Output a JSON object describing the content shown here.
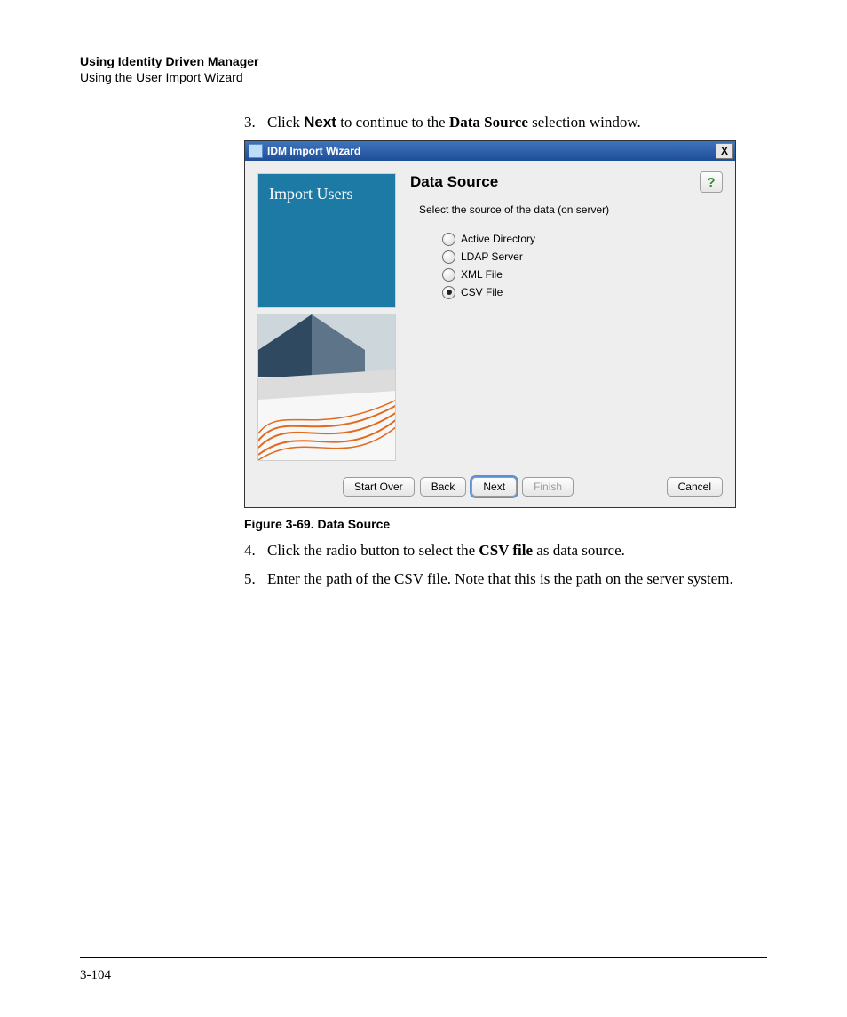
{
  "header": {
    "line1": "Using Identity Driven Manager",
    "line2": "Using the User Import Wizard"
  },
  "steps": {
    "s3": {
      "num": "3.",
      "pre": "Click ",
      "b1": "Next",
      "mid": " to continue to the ",
      "b2": "Data Source",
      "post": " selection window."
    },
    "s4": {
      "num": "4.",
      "pre": "Click the radio button to select the ",
      "b1": "CSV file",
      "post": " as data source."
    },
    "s5": {
      "num": "5.",
      "text": "Enter the path of the CSV file. Note that this is the path on the server system."
    }
  },
  "figure_caption": "Figure 3-69. Data Source",
  "dialog": {
    "title": "IDM Import Wizard",
    "side_title": "Import Users",
    "panel_title": "Data Source",
    "panel_sub": "Select the source of the data (on server)",
    "options": {
      "o1": "Active Directory",
      "o2": "LDAP Server",
      "o3": "XML File",
      "o4": "CSV File"
    },
    "buttons": {
      "start_over": "Start Over",
      "back": "Back",
      "next": "Next",
      "finish": "Finish",
      "cancel": "Cancel"
    },
    "help_glyph": "?",
    "close_glyph": "X"
  },
  "page_number": "3-104"
}
